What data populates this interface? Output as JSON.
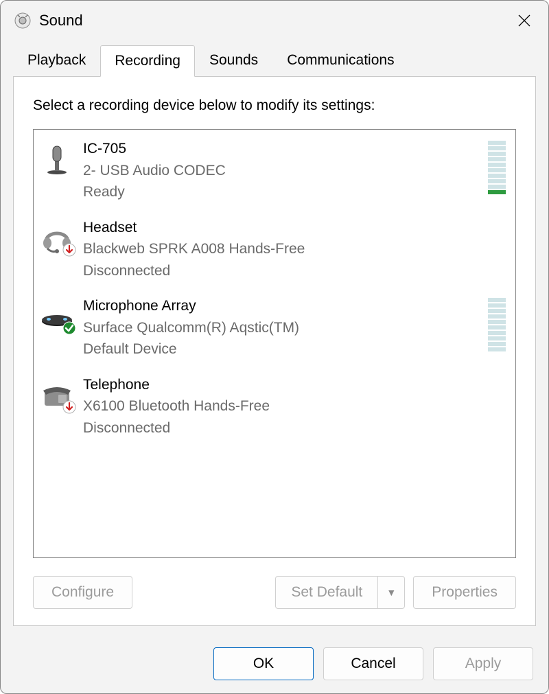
{
  "window": {
    "title": "Sound"
  },
  "tabs": [
    {
      "label": "Playback",
      "active": false
    },
    {
      "label": "Recording",
      "active": true
    },
    {
      "label": "Sounds",
      "active": false
    },
    {
      "label": "Communications",
      "active": false
    }
  ],
  "instruction": "Select a recording device below to modify its settings:",
  "devices": [
    {
      "name": "IC-705",
      "description": "2- USB Audio CODEC",
      "status": "Ready",
      "icon": "microphone",
      "overlay": null,
      "meter": {
        "segments": 10,
        "active": 1
      }
    },
    {
      "name": "Headset",
      "description": "Blackweb SPRK A008 Hands-Free",
      "status": "Disconnected",
      "icon": "headset",
      "overlay": "down-red",
      "meter": null
    },
    {
      "name": "Microphone Array",
      "description": "Surface Qualcomm(R) Aqstic(TM)",
      "status": "Default Device",
      "icon": "mic-array",
      "overlay": "check-green",
      "meter": {
        "segments": 10,
        "active": 0
      }
    },
    {
      "name": "Telephone",
      "description": "X6100 Bluetooth Hands-Free",
      "status": "Disconnected",
      "icon": "telephone",
      "overlay": "down-red",
      "meter": null
    }
  ],
  "content_buttons": {
    "configure": "Configure",
    "set_default": "Set Default",
    "properties": "Properties"
  },
  "footer": {
    "ok": "OK",
    "cancel": "Cancel",
    "apply": "Apply"
  }
}
